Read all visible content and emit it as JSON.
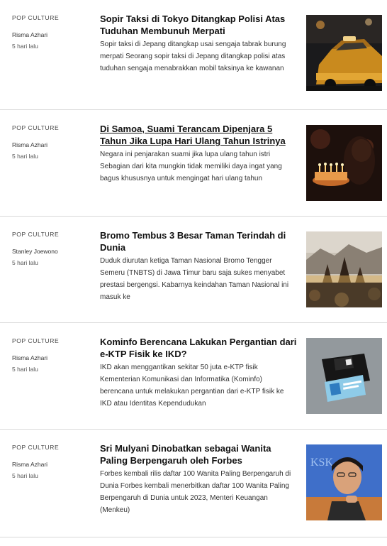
{
  "articles": [
    {
      "category": "POP CULTURE",
      "author": "Risma Azhari",
      "time": "5 hari lalu",
      "title": "Sopir Taksi di Tokyo Ditangkap Polisi Atas Tuduhan Membunuh Merpati",
      "excerpt": "Sopir taksi di Jepang ditangkap usai sengaja tabrak burung merpati Seorang sopir taksi di Jepang ditangkap polisi atas tuduhan sengaja menabrakkan mobil taksinya ke kawanan"
    },
    {
      "category": "POP CULTURE",
      "author": "Risma Azhari",
      "time": "5 hari lalu",
      "title": "Di Samoa, Suami Terancam Dipenjara 5 Tahun Jika Lupa Hari Ulang Tahun Istrinya",
      "excerpt": "Negara ini penjarakan suami jika lupa ulang tahun istri Sebagian dari kita mungkin tidak memiliki daya ingat yang bagus khususnya untuk mengingat hari ulang tahun"
    },
    {
      "category": "POP CULTURE",
      "author": "Stanley Joewono",
      "time": "5 hari lalu",
      "title": "Bromo Tembus 3 Besar Taman Terindah di Dunia",
      "excerpt": "Duduk diurutan ketiga Taman Nasional Bromo Tengger Semeru (TNBTS) di Jawa Timur baru saja sukes menyabet prestasi bergengsi. Kabarnya keindahan Taman Nasional ini masuk ke"
    },
    {
      "category": "POP CULTURE",
      "author": "Risma Azhari",
      "time": "5 hari lalu",
      "title": "Kominfo Berencana Lakukan Pergantian dari e-KTP Fisik ke IKD?",
      "excerpt": "IKD akan menggantikan sekitar 50 juta e-KTP fisik Kementerian Komunikasi dan Informatika (Kominfo) berencana untuk melakukan pergantian dari e-KTP fisik ke IKD atau Identitas Kependudukan"
    },
    {
      "category": "POP CULTURE",
      "author": "Risma Azhari",
      "time": "5 hari lalu",
      "title": "Sri Mulyani Dinobatkan sebagai Wanita Paling Berpengaruh oleh Forbes",
      "excerpt": "Forbes kembali rilis daftar 100 Wanita Paling Berpengaruh di Dunia Forbes kembali menerbitkan daftar 100 Wanita Paling Berpengaruh di Dunia untuk 2023, Menteri Keuangan (Menkeu)"
    }
  ],
  "thumb_text": {
    "backdrop": "KSK"
  }
}
